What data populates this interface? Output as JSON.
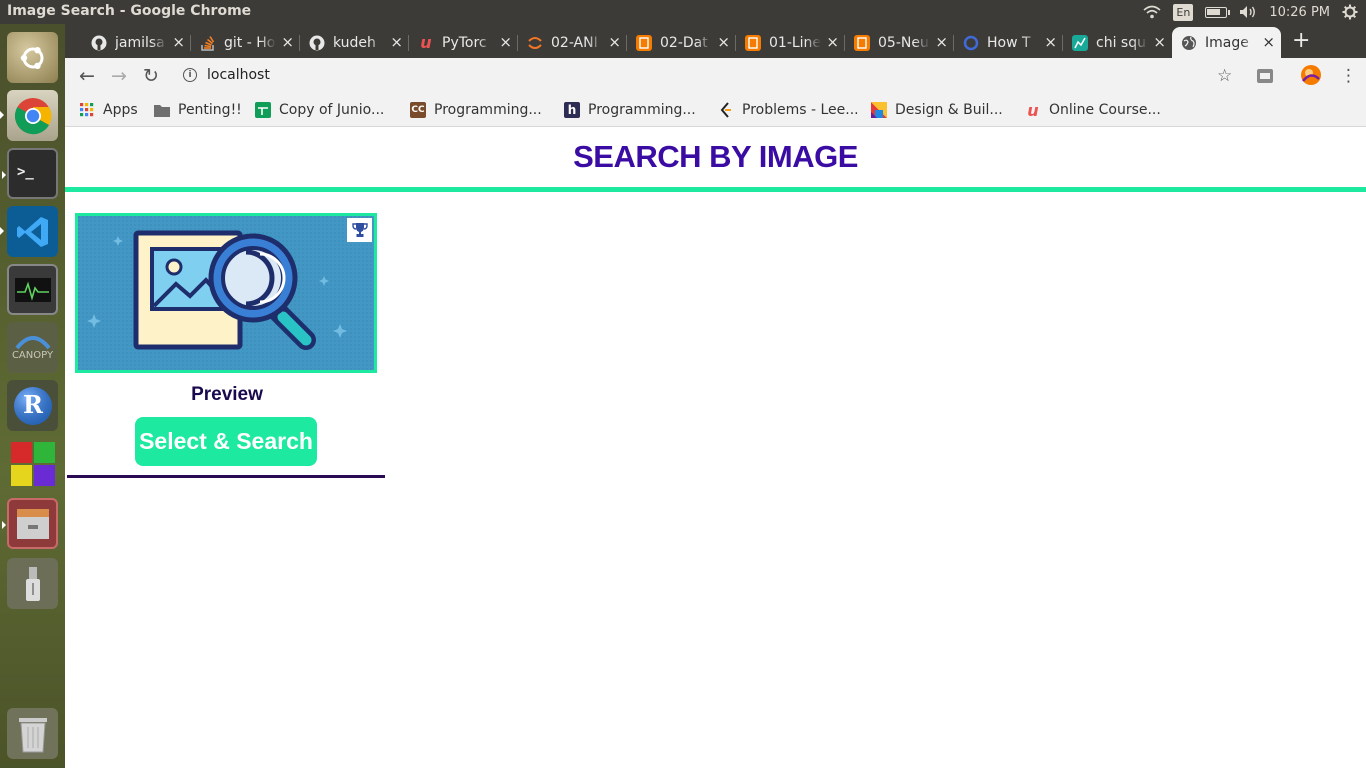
{
  "window": {
    "title": "Image Search - Google Chrome"
  },
  "system_tray": {
    "keyboard_layout": "En",
    "clock": "10:26 PM",
    "icons": [
      "wifi-icon",
      "battery-icon",
      "volume-icon",
      "settings-gear-icon"
    ],
    "battery_level": 0.7
  },
  "launcher": {
    "items": [
      {
        "name": "ubuntu-dash-icon"
      },
      {
        "name": "chrome-icon"
      },
      {
        "name": "terminal-icon"
      },
      {
        "name": "vscode-icon"
      },
      {
        "name": "system-monitor-icon"
      },
      {
        "name": "canopy-icon",
        "label": "CANOPY"
      },
      {
        "name": "r-icon",
        "label": "R"
      },
      {
        "name": "workspace-switcher-icon"
      },
      {
        "name": "file-manager-icon"
      },
      {
        "name": "usb-drive-icon"
      },
      {
        "name": "trash-icon"
      }
    ]
  },
  "tabs": [
    {
      "label": "jamilsa",
      "icon": "github-icon",
      "color": "#e8e8e8"
    },
    {
      "label": "git - Ho",
      "icon": "stackoverflow-icon",
      "color": "#f48024"
    },
    {
      "label": "kudeh",
      "icon": "github-icon",
      "color": "#e8e8e8"
    },
    {
      "label": "PyTorc",
      "icon": "udemy-icon",
      "color": "#ec5252"
    },
    {
      "label": "02-ANI",
      "icon": "jupyter-icon",
      "color": "#f37626"
    },
    {
      "label": "02-Dat",
      "icon": "notebook-icon",
      "color": "#f57c00"
    },
    {
      "label": "01-Line",
      "icon": "notebook-icon",
      "color": "#f57c00"
    },
    {
      "label": "05-Neu",
      "icon": "notebook-icon",
      "color": "#f57c00"
    },
    {
      "label": "How T",
      "icon": "codementor-icon",
      "color": "#3f6ad8"
    },
    {
      "label": "chi squ",
      "icon": "chart-icon",
      "color": "#18a999"
    },
    {
      "label": "Image",
      "icon": "globe-icon",
      "color": "#555555",
      "active": true
    }
  ],
  "toolbar": {
    "url": "localhost",
    "back_icon": "back-arrow-icon",
    "forward_icon": "forward-arrow-icon",
    "reload_icon": "reload-icon"
  },
  "bookmarks": [
    {
      "label": "Apps",
      "icon": "apps-grid-icon"
    },
    {
      "label": "Penting!!",
      "icon": "folder-icon"
    },
    {
      "label": "Copy of Junio...",
      "icon": "sheets-icon",
      "color": "#0f9d58"
    },
    {
      "label": "Programming...",
      "icon": "cc-icon",
      "color": "#7a4b2a"
    },
    {
      "label": "Programming...",
      "icon": "hackerrank-icon",
      "color": "#2c2c54"
    },
    {
      "label": "Problems - Lee...",
      "icon": "leetcode-icon",
      "color": "#f89f1b"
    },
    {
      "label": "Design & Buil...",
      "icon": "coursera-icon",
      "color": "#6a1b9a"
    },
    {
      "label": "Online Course...",
      "icon": "udemy-icon",
      "color": "#ec5252"
    }
  ],
  "page": {
    "title": "SEARCH BY IMAGE",
    "preview_label": "Preview",
    "select_button": "Select & Search"
  },
  "colors": {
    "title": "#3a0ca3",
    "accent": "#1de9a0",
    "dark_rule": "#2a0a55",
    "preview_bg": "#3f8fbf",
    "preview_label": "#1a0a4d"
  }
}
